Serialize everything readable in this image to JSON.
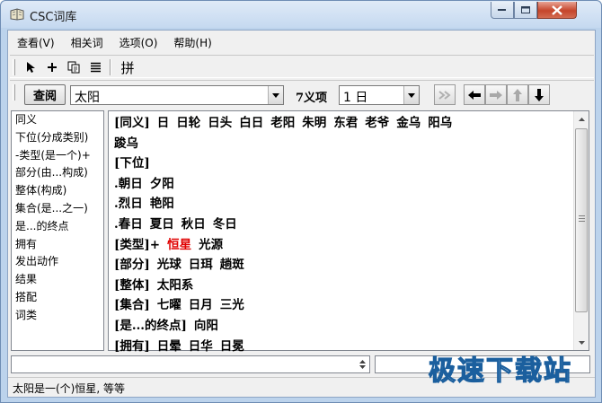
{
  "window": {
    "title": "CSC词库"
  },
  "menu": [
    "查看(V)",
    "相关词",
    "选项(O)",
    "帮助(H)"
  ],
  "toolbar": {
    "icons": [
      "pointer-icon",
      "plus-icon",
      "copy-icon",
      "list-icon"
    ],
    "pin_label": "拼"
  },
  "search": {
    "button": "查阅",
    "query": "太阳",
    "sense_label": "7义项",
    "sense_value": "1 日"
  },
  "relations": [
    "同义",
    "下位(分成类别)",
    "-类型(是一个)+",
    "部分(由...构成)",
    "整体(构成)",
    "集合(是...之一)",
    "是...的终点",
    "拥有",
    "发出动作",
    "结果",
    "搭配",
    "词类"
  ],
  "results": [
    {
      "words": [
        "[同义]",
        "日",
        "日轮",
        "日头",
        "白日",
        "老阳",
        "朱明",
        "东君",
        "老爷",
        "金乌",
        "阳乌"
      ]
    },
    {
      "words": [
        "踆乌"
      ]
    },
    {
      "words": [
        "[下位]"
      ]
    },
    {
      "words": [
        ".朝日",
        "夕阳"
      ]
    },
    {
      "words": [
        ".烈日",
        "艳阳"
      ]
    },
    {
      "words": [
        ".春日",
        "夏日",
        "秋日",
        "冬日"
      ]
    },
    {
      "words": [
        "[类型]+"
      ],
      "highlight": "恒星",
      "after": [
        "光源"
      ]
    },
    {
      "words": [
        "[部分]",
        "光球",
        "日珥",
        "趟斑"
      ]
    },
    {
      "words": [
        "[整体]",
        "太阳系"
      ]
    },
    {
      "words": [
        "[集合]",
        "七曜",
        "日月",
        "三光"
      ]
    },
    {
      "words": [
        "[是...的终点]",
        "向阳"
      ]
    },
    {
      "words": [
        "[拥有]",
        "日晕",
        "日华",
        "日冕"
      ]
    }
  ],
  "status": {
    "text": "太阳是一(个)恒星, 等等"
  },
  "watermark": {
    "text": "极速下载站"
  },
  "colors": {
    "highlight": "#e00000",
    "titlebar": "#c5d9f0",
    "close": "#c5452b"
  }
}
